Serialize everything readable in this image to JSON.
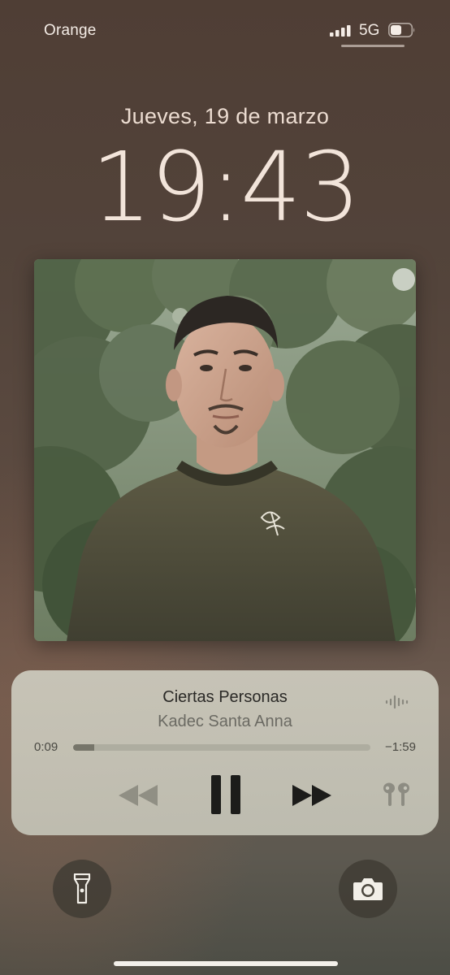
{
  "status_bar": {
    "carrier": "Orange",
    "network": "5G",
    "signal_bars": 4,
    "battery_level": 0.5,
    "icons": [
      "signal-bars-icon",
      "battery-icon"
    ]
  },
  "lock_screen": {
    "date": "Jueves, 19 de marzo",
    "time": "19:43"
  },
  "now_playing": {
    "title": "Ciertas Personas",
    "artist": "Kadec Santa Anna",
    "elapsed": "0:09",
    "remaining": "−1:59",
    "progress": 0.07,
    "state": "playing",
    "icons": [
      "waveform-icon",
      "rewind-icon",
      "pause-icon",
      "fast-forward-icon",
      "airpods-icon"
    ]
  },
  "quick_actions": {
    "left": "flashlight-icon",
    "right": "camera-icon"
  },
  "colors": {
    "widget_background": "#cdcbbe",
    "accent_text": "#2a2926"
  }
}
